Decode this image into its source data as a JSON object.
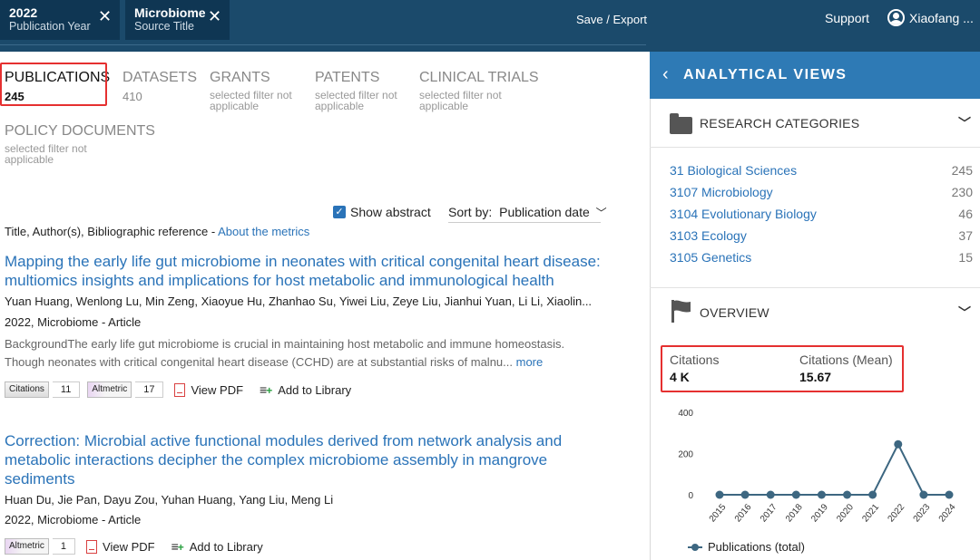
{
  "top_bar": {
    "chips": [
      {
        "value": "2022",
        "label": "Publication Year"
      },
      {
        "value": "Microbiome",
        "label": "Source Title"
      }
    ],
    "save_export": "Save / Export",
    "support": "Support",
    "user_name": "Xiaofang ..."
  },
  "tabs": [
    {
      "name": "PUBLICATIONS",
      "count": "245"
    },
    {
      "name": "DATASETS",
      "count": "410"
    },
    {
      "name": "GRANTS",
      "note": "selected filter not applicable"
    },
    {
      "name": "PATENTS",
      "note": "selected filter not applicable"
    },
    {
      "name": "CLINICAL TRIALS",
      "note": "selected filter not applicable"
    },
    {
      "name": "POLICY DOCUMENTS",
      "note": "selected filter not applicable"
    }
  ],
  "list_controls": {
    "show_abstract": "Show abstract",
    "sort_label": "Sort by:",
    "sort_value": "Publication date",
    "column_header": "Title, Author(s), Bibliographic reference - ",
    "about_metrics": "About the metrics"
  },
  "results": [
    {
      "title": "Mapping the early life gut microbiome in neonates with critical congenital heart disease: multiomics insights and implications for host metabolic and immunological health",
      "authors": "Yuan Huang, Wenlong Lu, Min Zeng, Xiaoyue Hu, Zhanhao Su, Yiwei Liu, Zeye Liu, Jianhui Yuan, Li Li, Xiaolin...",
      "source": "2022, Microbiome - Article",
      "abstract": "BackgroundThe early life gut microbiome is crucial in maintaining host metabolic and immune homeostasis. Though neonates with critical congenital heart disease (CCHD) are at substantial risks of malnu...",
      "more": "more",
      "citations_label": "Citations",
      "citations": "11",
      "altmetric_label": "Altmetric",
      "altmetric": "17",
      "view_pdf": "View PDF",
      "add_to_library": "Add to Library"
    },
    {
      "title": "Correction: Microbial active functional modules derived from network analysis and metabolic interactions decipher the complex microbiome assembly in mangrove sediments",
      "authors": "Huan Du, Jie Pan, Dayu Zou, Yuhan Huang, Yang Liu, Meng Li",
      "source": "2022, Microbiome - Article",
      "altmetric_label": "Altmetric",
      "altmetric": "1",
      "view_pdf": "View PDF",
      "add_to_library": "Add to Library"
    }
  ],
  "panel": {
    "title": "ANALYTICAL VIEWS",
    "research_categories_label": "RESEARCH CATEGORIES",
    "categories": [
      {
        "name": "31 Biological Sciences",
        "count": "245"
      },
      {
        "name": "3107 Microbiology",
        "count": "230"
      },
      {
        "name": "3104 Evolutionary Biology",
        "count": "46"
      },
      {
        "name": "3103 Ecology",
        "count": "37"
      },
      {
        "name": "3105 Genetics",
        "count": "15"
      }
    ],
    "overview_label": "OVERVIEW",
    "citations_label": "Citations",
    "citations_value": "4 K",
    "citations_mean_label": "Citations (Mean)",
    "citations_mean_value": "15.67"
  },
  "chart_data": {
    "type": "line",
    "x": [
      "2015",
      "2016",
      "2017",
      "2018",
      "2019",
      "2020",
      "2021",
      "2022",
      "2023",
      "2024"
    ],
    "series": [
      {
        "name": "Publications (total)",
        "values": [
          0,
          0,
          0,
          0,
          0,
          0,
          0,
          245,
          0,
          0
        ]
      }
    ],
    "y_ticks": [
      0,
      200,
      400
    ],
    "ylim": [
      0,
      400
    ],
    "color": "#3d6781",
    "legend": "bottom"
  }
}
